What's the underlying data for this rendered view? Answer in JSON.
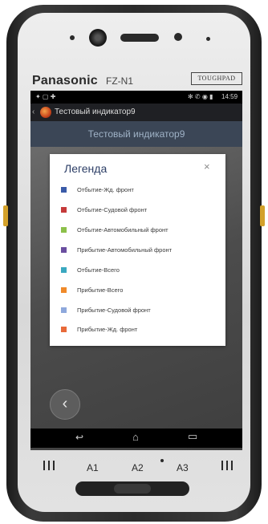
{
  "device": {
    "brand": "Panasonic",
    "model": "FZ-N1",
    "badge": "TOUGHPAD",
    "hw_keys": [
      "A1",
      "A2",
      "A3"
    ]
  },
  "statusbar": {
    "time": "14:59",
    "left_icons": "✦ ▢ ✚",
    "right_icons": "✻ ✆ ◉ ▮"
  },
  "app": {
    "appbar_title": "Тестовый индикатор9",
    "page_title": "Тестовый индикатор9"
  },
  "legend_modal": {
    "title": "Легенда",
    "close_glyph": "×",
    "items": [
      {
        "label": "Отбытие-Жд. фронт",
        "color": "#3a5ba8"
      },
      {
        "label": "Отбытие-Судовой фронт",
        "color": "#c53a3a"
      },
      {
        "label": "Отбытие-Автомобильный фронт",
        "color": "#8cc04a"
      },
      {
        "label": "Прибытие-Автомобильный фронт",
        "color": "#6a4ea0"
      },
      {
        "label": "Отбытие-Всего",
        "color": "#3aa8c0"
      },
      {
        "label": "Прибытие-Всего",
        "color": "#f08a2a"
      },
      {
        "label": "Прибытие-Судовой фронт",
        "color": "#8ea8dc"
      },
      {
        "label": "Прибытие-Жд. фронт",
        "color": "#e86a3a"
      }
    ]
  },
  "navbar": {
    "back_glyph": "↩",
    "home_glyph": "⌂",
    "recents_glyph": "▭"
  },
  "back_button_glyph": "‹"
}
